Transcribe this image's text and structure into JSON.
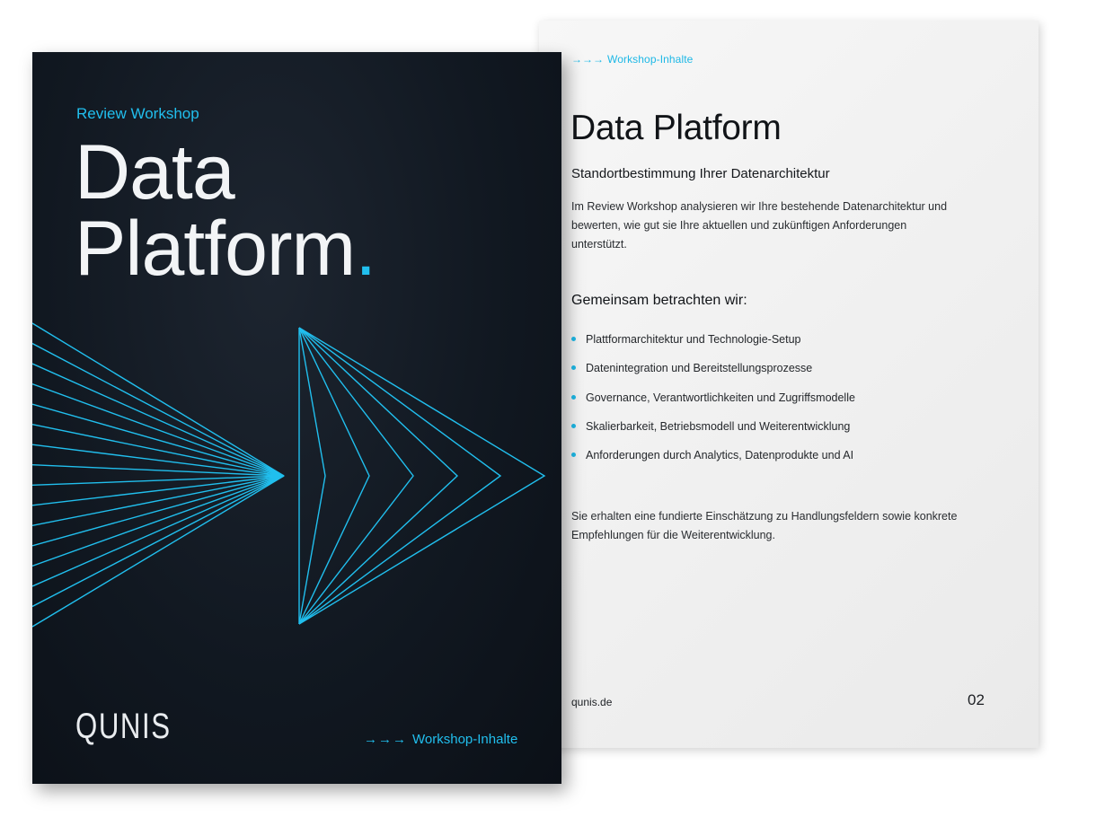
{
  "back_page": {
    "kicker_arrows": "→→→",
    "kicker": "Workshop-Inhalte",
    "title": "Data Platform",
    "subtitle": "Standortbestimmung Ihrer Datenarchitektur",
    "intro": "Im Review Workshop analysieren wir Ihre bestehende Datenarchitektur und bewerten, wie gut sie Ihre aktuellen und zukünftigen Anforderungen unterstützt.",
    "section_heading": "Gemeinsam betrachten wir:",
    "bullets": [
      "Plattformarchitektur und Technologie-Setup",
      "Datenintegration und Bereitstellungsprozesse",
      "Governance, Verantwortlichkeiten und Zugriffsmodelle",
      "Skalierbarkeit, Betriebsmodell und Weiterentwicklung",
      "Anforderungen durch Analytics, Datenprodukte und AI"
    ],
    "closing": "Sie erhalten eine fundierte Einschätzung zu Handlungsfeldern sowie konkrete Empfehlungen für die Weiterentwicklung.",
    "footer_url": "qunis.de",
    "page_number": "02"
  },
  "cover": {
    "kicker": "Review Workshop",
    "title_line1": "Data",
    "title_line2": "Platform",
    "title_dot": ".",
    "logo": "QUNIS",
    "link_arrows": "→→→",
    "link": "Workshop-Inhalte"
  },
  "colors": {
    "accent": "#21bfee",
    "cover_bg": "#111821",
    "page_bg": "#f2f2f2"
  }
}
